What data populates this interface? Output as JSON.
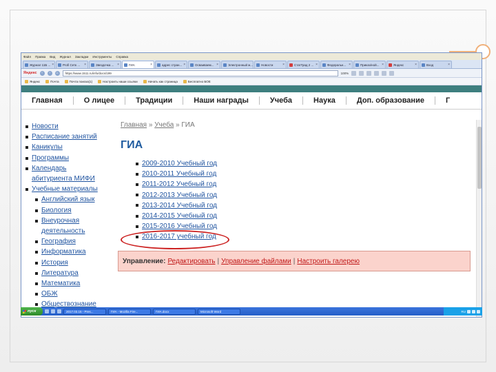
{
  "browser": {
    "menu": [
      "Файл",
      "Правка",
      "Вид",
      "Журнал",
      "Закладки",
      "Инструменты",
      "Справка"
    ],
    "tabs": [
      {
        "label": "Журнал 11Б ...",
        "icon": "page-icon",
        "active": false
      },
      {
        "label": "Profi Сетк ...",
        "icon": "page-icon",
        "active": false
      },
      {
        "label": "Звездочка ...",
        "icon": "page-icon",
        "active": false
      },
      {
        "label": "ГИА",
        "icon": "page-icon",
        "active": true
      },
      {
        "label": "адрес стран...",
        "icon": "page-icon",
        "active": false
      },
      {
        "label": "Осваиваем...",
        "icon": "page-icon",
        "active": false
      },
      {
        "label": "Электронный ж...",
        "icon": "page-icon",
        "active": false
      },
      {
        "label": "Новости",
        "icon": "page-icon",
        "active": false
      },
      {
        "label": "СтатГрад 2 ...",
        "icon": "mail-icon",
        "active": false
      },
      {
        "label": "Федеральн...",
        "icon": "page-icon",
        "active": false
      },
      {
        "label": "Приказ/ной...",
        "icon": "page-icon",
        "active": false
      },
      {
        "label": "Яндекс",
        "icon": "yandex-icon",
        "active": false
      },
      {
        "label": "Вход",
        "icon": "page-icon",
        "active": false
      }
    ],
    "nav": {
      "yandex_label": "Яндекс",
      "url": "https://www.1511.ru/info/docs/199",
      "zoom": "100%"
    },
    "bookmarks": [
      "Яндекс",
      "Почта",
      "Почта поиска(1)",
      "Настроить наши ссылки",
      "Начать как страница",
      "Бесплатно БОЕ"
    ]
  },
  "site": {
    "nav": [
      "Главная",
      "О лицее",
      "Традиции",
      "Наши награды",
      "Учеба",
      "Наука",
      "Доп. образование",
      "Г"
    ],
    "sidebar": [
      {
        "label": "Новости",
        "level": 0
      },
      {
        "label": "Расписание занятий",
        "level": 0
      },
      {
        "label": "Каникулы",
        "level": 0
      },
      {
        "label": "Программы",
        "level": 0
      },
      {
        "label": "Календарь",
        "level": 0
      },
      {
        "label": "абитуриента МИФИ",
        "level": 0,
        "continuation": true
      },
      {
        "label": "Учебные материалы",
        "level": 0
      },
      {
        "label": "Английский язык",
        "level": 1
      },
      {
        "label": "Биология",
        "level": 1
      },
      {
        "label": "Внеурочная",
        "level": 1
      },
      {
        "label": "деятельность",
        "level": 1,
        "continuation": true
      },
      {
        "label": "География",
        "level": 1
      },
      {
        "label": "Информатика",
        "level": 1
      },
      {
        "label": "История",
        "level": 1
      },
      {
        "label": "Литература",
        "level": 1
      },
      {
        "label": "Математика",
        "level": 1
      },
      {
        "label": "ОБЖ",
        "level": 1
      },
      {
        "label": "Обществознание",
        "level": 1
      }
    ],
    "breadcrumb": {
      "home": "Главная",
      "sep1": " » ",
      "section": "Учеба",
      "sep2": " » ",
      "current": "ГИА"
    },
    "title": "ГИА",
    "years": [
      "2009-2010 Учебный год",
      "2010-2011 Учебный год",
      "2011-2012 Учебный год",
      "2012-2013 Учебный год",
      "2013-2014 Учебный год",
      "2014-2015 Учебный год",
      "2015-2016 Учебный год",
      "2016-2017 учебный год"
    ],
    "admin": {
      "label": "Управление:",
      "edit": "Редактировать",
      "sep1": "|",
      "files": "Управление файлами",
      "sep2": "|",
      "gallery": "Настроить галерею"
    }
  },
  "taskbar": {
    "start": "пуск",
    "tasks": [
      "2017.03.15 - Pres...",
      "ГИА - Mozilla Fire...",
      "ГИА.docx",
      "Microsoft Word"
    ],
    "clock": "RU"
  },
  "colors": {
    "link": "#2054a0",
    "title": "#1f5b9f",
    "highlight": "#cc2222",
    "admin_bg": "#fbd3cc",
    "site_band": "#3e7f7f"
  }
}
